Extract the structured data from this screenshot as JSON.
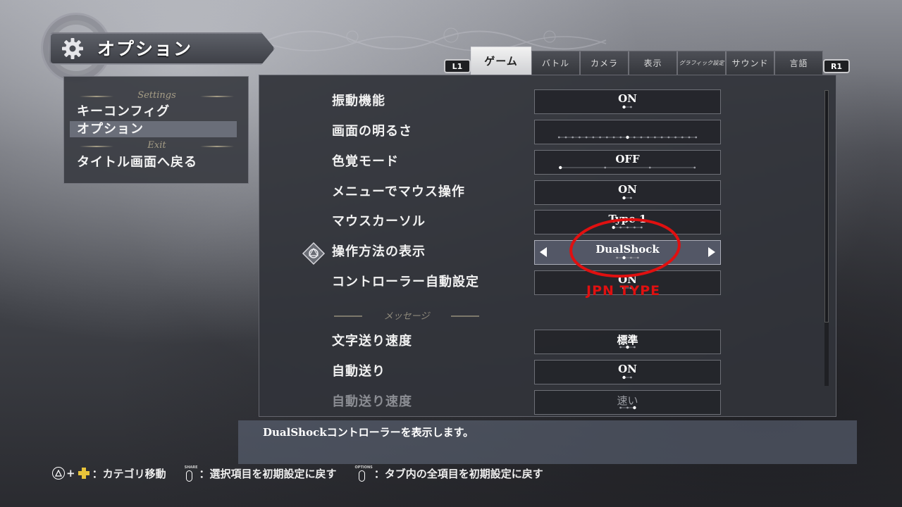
{
  "title": {
    "text": "オプション",
    "icon": "gear-icon"
  },
  "tabs": {
    "left_shoulder": "L1",
    "right_shoulder": "R1",
    "items": [
      {
        "label": "ゲーム",
        "active": true
      },
      {
        "label": "バトル"
      },
      {
        "label": "カメラ"
      },
      {
        "label": "表示"
      },
      {
        "label": "グラフィック設定"
      },
      {
        "label": "サウンド"
      },
      {
        "label": "言語"
      }
    ]
  },
  "left_menu": {
    "settings_header": "Settings",
    "items": [
      {
        "label": "キーコンフィグ"
      },
      {
        "label": "オプション",
        "selected": true
      }
    ],
    "exit_header": "Exit",
    "exit_item": "タイトル画面へ戻る"
  },
  "settings": [
    {
      "label": "振動機能",
      "value": "ON",
      "dot_count": 2,
      "selected_index": 0
    },
    {
      "label": "画面の明るさ",
      "value": "",
      "dot_count": 21,
      "selected_index": 10
    },
    {
      "label": "色覚モード",
      "value": "OFF",
      "dot_count": 4,
      "selected_index": 0
    },
    {
      "label": "メニューでマウス操作",
      "value": "ON",
      "dot_count": 2,
      "selected_index": 0
    },
    {
      "label": "マウスカーソル",
      "value": "Type 1",
      "dot_count": 5,
      "selected_index": 0
    },
    {
      "label": "操作方法の表示",
      "value": "DualShock",
      "dot_count": 4,
      "selected_index": 1,
      "highlighted": true
    },
    {
      "label": "コントローラー自動設定",
      "value": "ON",
      "dot_count": 2,
      "selected_index": 0
    }
  ],
  "message_section": {
    "header": "メッセージ",
    "items": [
      {
        "label": "文字送り速度",
        "value": "標準",
        "dot_count": 3,
        "selected_index": 1
      },
      {
        "label": "自動送り",
        "value": "ON",
        "dot_count": 2,
        "selected_index": 0
      },
      {
        "label": "自動送り速度",
        "value": "速い",
        "dot_count": 3,
        "selected_index": 2,
        "disabled": true
      }
    ]
  },
  "annotation": {
    "text": "JPN TYPE",
    "color": "#e01010"
  },
  "description": "DualShockコントローラーを表示します。",
  "footer": {
    "category_move": "：カテゴリ移動",
    "share_label": "SHARE",
    "reset_selected": "：選択項目を初期設定に戻す",
    "options_label": "OPTIONS",
    "reset_tab": "：タブ内の全項目を初期設定に戻す"
  },
  "colors": {
    "accent_header": "#a59d86",
    "panel_bg": "#32343a",
    "highlight_row": "#555a68",
    "dpad": "#e8c43a"
  }
}
